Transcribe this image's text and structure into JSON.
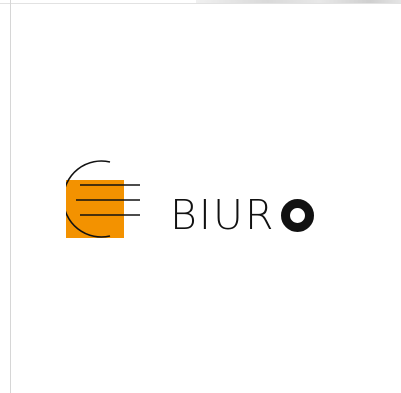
{
  "logo": {
    "name": "biuro-logo",
    "wordmark_text": "BIUR",
    "wordmark_bold_letter": "O",
    "colors": {
      "accent_square": "#f39200",
      "ink": "#111111",
      "background": "#ffffff"
    },
    "icon": "biuro-logomark-icon"
  }
}
